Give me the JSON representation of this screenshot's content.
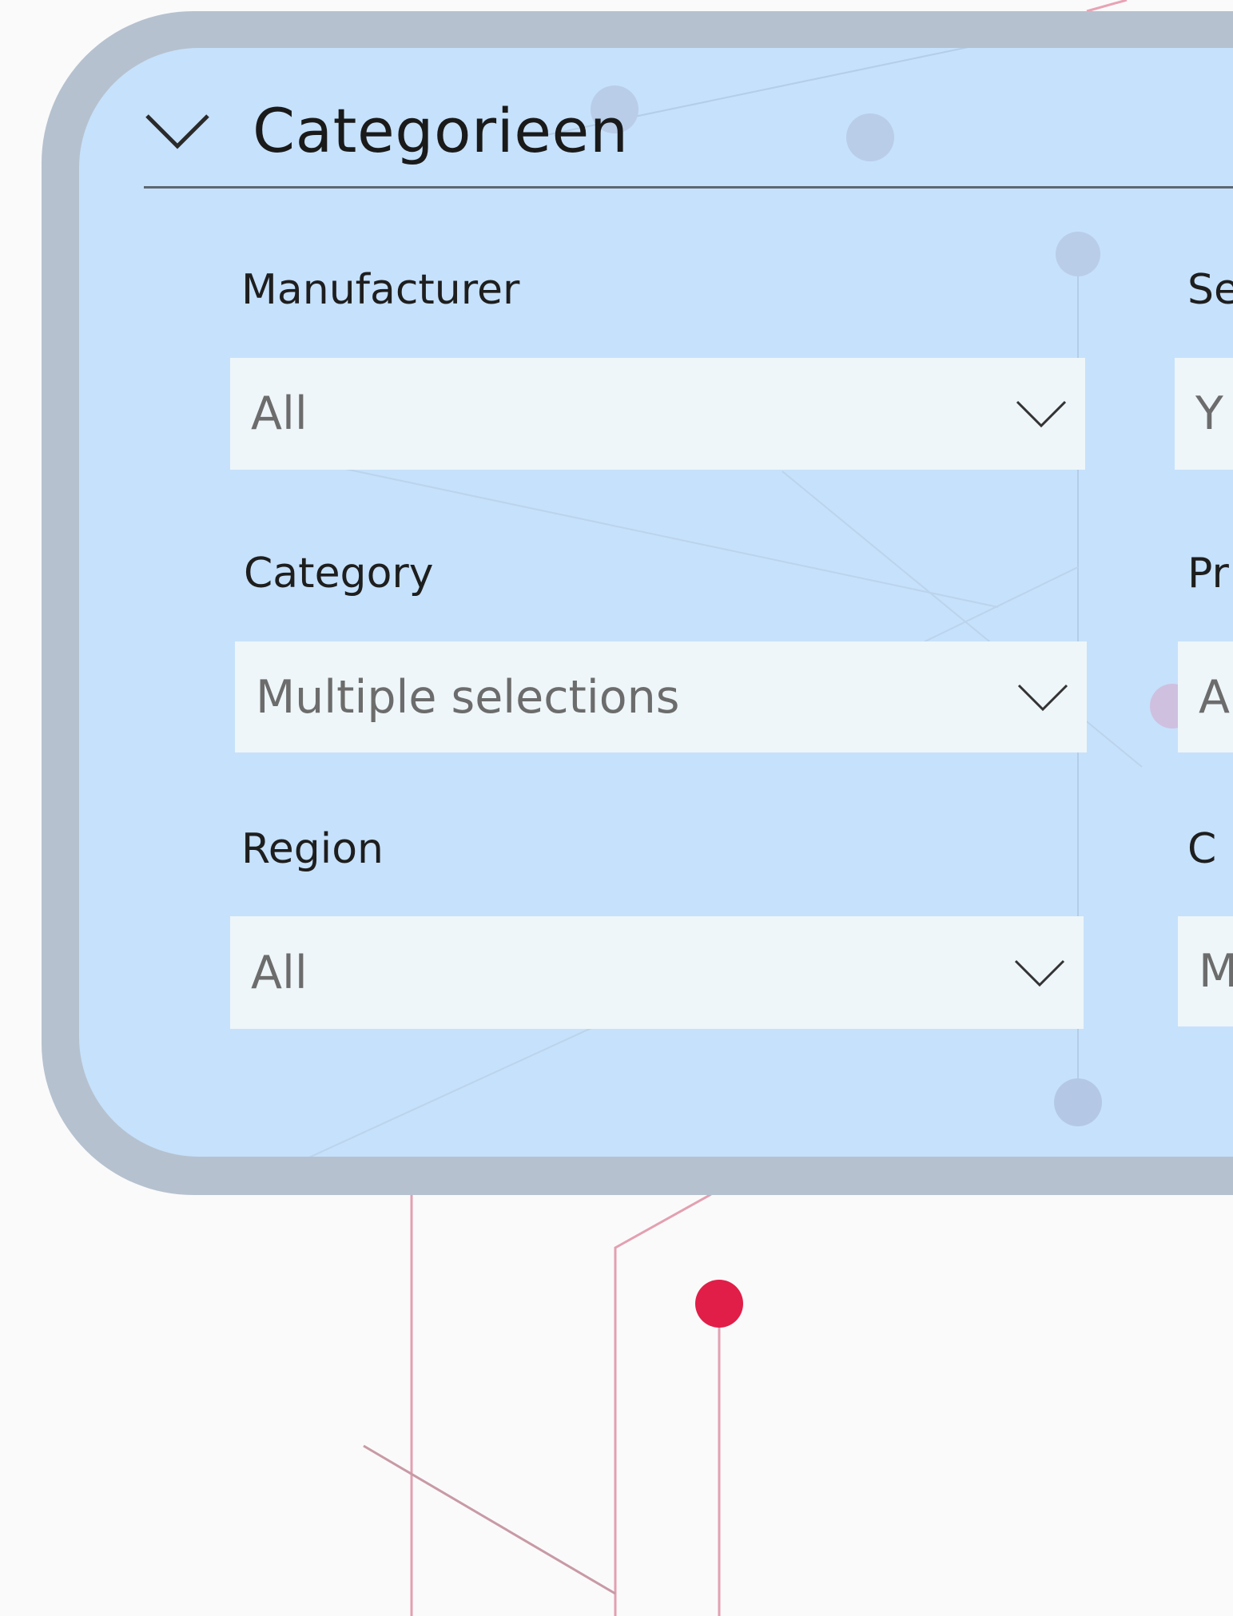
{
  "panel": {
    "title": "Categorieen"
  },
  "filters": {
    "left": [
      {
        "label": "Manufacturer",
        "value": "All"
      },
      {
        "label": "Category",
        "value": "Multiple selections"
      },
      {
        "label": "Region",
        "value": "All"
      }
    ],
    "right": [
      {
        "label": "Se",
        "value": "Y"
      },
      {
        "label": "Pr",
        "value": "A"
      },
      {
        "label": "C",
        "value": "M"
      }
    ]
  },
  "colors": {
    "panel_bg": "#c6e1fb",
    "panel_border": "#b6c1cf",
    "select_bg": "#eef6f9",
    "accent_dot": "#e01e48"
  }
}
